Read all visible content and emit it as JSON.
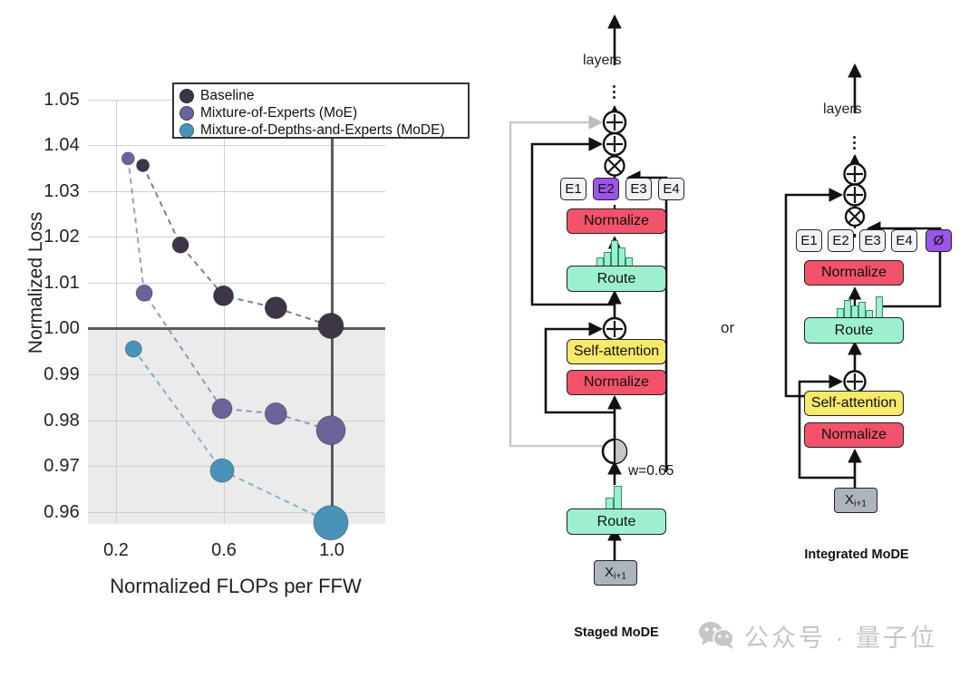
{
  "chart_data": {
    "type": "scatter",
    "title": "",
    "xlabel": "Normalized FLOPs per FFW",
    "ylabel": "Normalized Loss",
    "xlim": [
      0.13,
      1.12
    ],
    "ylim": [
      0.9535,
      1.0545
    ],
    "xticks": [
      "0.2",
      "0.6",
      "1.0"
    ],
    "xtick_values": [
      0.2,
      0.6,
      1.0
    ],
    "yticks": [
      "1.05",
      "1.04",
      "1.03",
      "1.02",
      "1.01",
      "1.00",
      "0.99",
      "0.98",
      "0.97",
      "0.96"
    ],
    "ytick_values": [
      1.05,
      1.04,
      1.03,
      1.02,
      1.01,
      1.0,
      0.99,
      0.98,
      0.97,
      0.96
    ],
    "grid": true,
    "legend_position": "upper right",
    "reference_line_y": 1.0,
    "reference_line_x": 1.0,
    "shaded_below_reference": true,
    "series": [
      {
        "name": "Baseline",
        "color": "#3e3648",
        "x": [
          0.3,
          0.44,
          0.6,
          0.795,
          1.0
        ],
        "y": [
          1.035,
          1.0178,
          1.0068,
          1.0042,
          1.0003
        ],
        "sizes": [
          7,
          9,
          11,
          12,
          14
        ]
      },
      {
        "name": "Mixture-of-Experts (MoE)",
        "color": "#6b6499",
        "x": [
          0.245,
          0.305,
          0.595,
          0.795,
          1.0
        ],
        "y": [
          1.0365,
          1.0074,
          0.9824,
          0.9813,
          0.9777
        ],
        "sizes": [
          7,
          9,
          11,
          12,
          16
        ]
      },
      {
        "name": "Mixture-of-Depths-and-Experts (MoDE)",
        "color": "#4a93b8",
        "x": [
          0.265,
          0.595,
          1.0
        ],
        "y": [
          0.9953,
          0.969,
          0.9577
        ],
        "sizes": [
          9,
          13,
          19
        ]
      }
    ]
  },
  "legend": {
    "items": [
      {
        "label": "Baseline",
        "color": "#3e3648"
      },
      {
        "label": "Mixture-of-Experts (MoE)",
        "color": "#6b6499"
      },
      {
        "label": "Mixture-of-Depths-and-Experts (MoDE)",
        "color": "#4a93b8"
      }
    ]
  },
  "diagrams": {
    "connector_or": "or",
    "staged": {
      "caption": "Staged MoDE",
      "layers_label": "layers",
      "input_label": "X",
      "input_sub": "i+1",
      "route_bottom": "Route",
      "weight_label": "w=0.65",
      "norm_lower": "Normalize",
      "self_attention": "Self-attention",
      "route_upper": "Route",
      "norm_upper": "Normalize",
      "experts": [
        "E1",
        "E2",
        "E3",
        "E4"
      ],
      "active_expert": "E2",
      "route_bottom_bars": [
        40,
        95
      ],
      "route_upper_bars": [
        35,
        55,
        100,
        70,
        35
      ]
    },
    "integrated": {
      "caption": "Integrated MoDE",
      "layers_label": "layers",
      "input_label": "X",
      "input_sub": "i+1",
      "norm_lower": "Normalize",
      "self_attention": "Self-attention",
      "route": "Route",
      "norm_upper": "Normalize",
      "experts": [
        "E1",
        "E2",
        "E3",
        "E4"
      ],
      "null_expert": "Ø",
      "route_bars": [
        45,
        85,
        60,
        75,
        40,
        100
      ]
    }
  },
  "watermark": {
    "text": "公众号 · 量子位",
    "icon": "wechat-icon",
    "color": "#c6c6c6"
  },
  "colors": {
    "normalize": "#f2536a",
    "attention": "#f7e96a",
    "route": "#9df0cd",
    "expert": "#f4f0fa",
    "expert_active": "#9b55e8",
    "input": "#adb4bd"
  }
}
